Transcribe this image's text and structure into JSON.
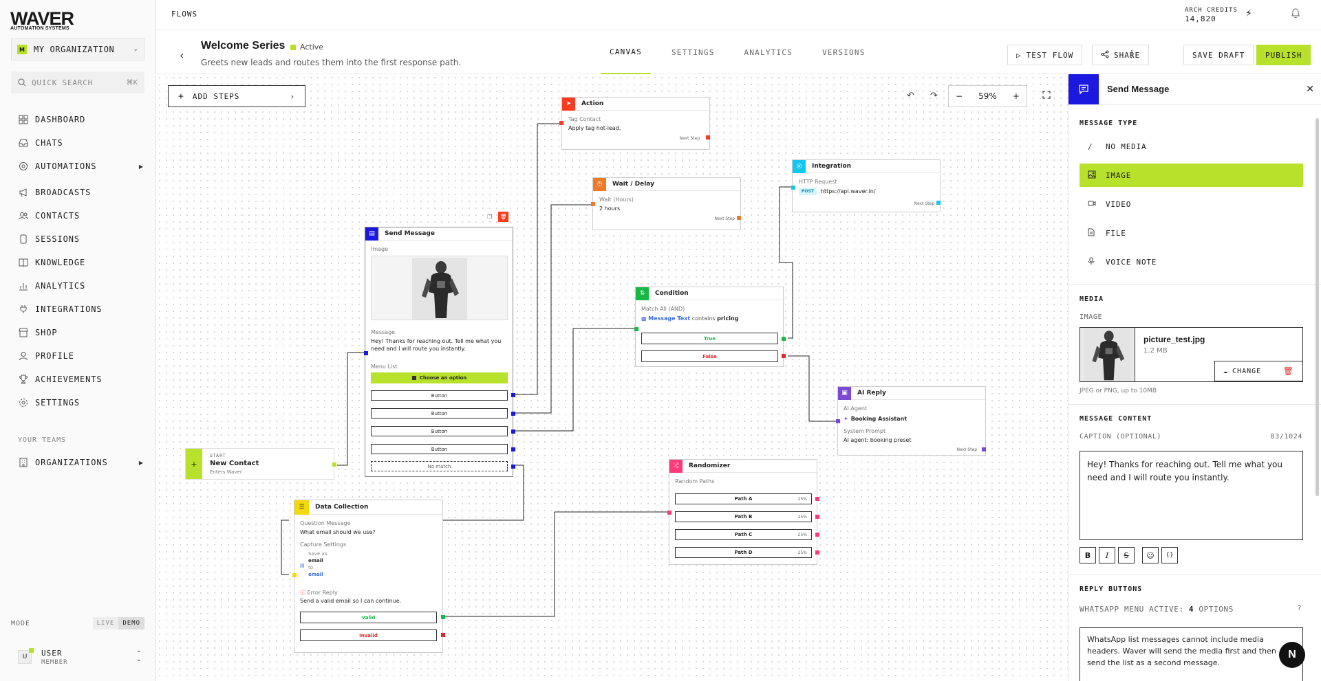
{
  "brand": {
    "name": "WAVER",
    "tagline": "AUTOMATION SYSTEMS"
  },
  "org": {
    "badge": "M",
    "name": "MY ORGANIZATION"
  },
  "search": {
    "placeholder": "QUICK SEARCH",
    "shortcut": "⌘K"
  },
  "nav": [
    {
      "label": "DASHBOARD",
      "icon": "dashboard-icon"
    },
    {
      "label": "CHATS",
      "icon": "inbox-icon"
    },
    {
      "label": "AUTOMATIONS",
      "icon": "automation-icon"
    },
    {
      "label": "BROADCASTS",
      "icon": "megaphone-icon"
    },
    {
      "label": "CONTACTS",
      "icon": "contacts-icon"
    },
    {
      "label": "SESSIONS",
      "icon": "phone-icon"
    },
    {
      "label": "KNOWLEDGE",
      "icon": "book-icon"
    },
    {
      "label": "ANALYTICS",
      "icon": "chart-icon"
    },
    {
      "label": "INTEGRATIONS",
      "icon": "plug-icon"
    },
    {
      "label": "SHOP",
      "icon": "shop-icon"
    },
    {
      "label": "PROFILE",
      "icon": "user-icon"
    },
    {
      "label": "ACHIEVEMENTS",
      "icon": "trophy-icon"
    },
    {
      "label": "SETTINGS",
      "icon": "gear-icon"
    }
  ],
  "teams": {
    "heading": "YOUR TEAMS",
    "item": "ORGANIZATIONS"
  },
  "mode": {
    "label": "MODE",
    "live": "LIVE",
    "demo": "DEMO"
  },
  "user": {
    "initial": "U",
    "name": "USER",
    "role": "MEMBER"
  },
  "topbar": {
    "breadcrumb": "FLOWS",
    "credits_label": "ARCH CREDITS",
    "credits_value": "14,820"
  },
  "flow": {
    "title": "Welcome Series",
    "status": "Active",
    "subtitle": "Greets new leads and routes them into the first response path."
  },
  "tabs": [
    "CANVAS",
    "SETTINGS",
    "ANALYTICS",
    "VERSIONS"
  ],
  "actions": {
    "test": "TEST FLOW",
    "share": "SHARE",
    "save": "SAVE DRAFT",
    "publish": "PUBLISH"
  },
  "canvas": {
    "add_steps": "ADD STEPS",
    "zoom": "59%"
  },
  "nodes": {
    "start": {
      "tag": "START",
      "title": "New Contact",
      "sub": "Enters Waver"
    },
    "action": {
      "title": "Action",
      "label": "Tag Contact",
      "text": "Apply tag hot-lead.",
      "next": "Next Step"
    },
    "wait": {
      "title": "Wait / Delay",
      "label": "Wait (Hours)",
      "text": "2 hours",
      "next": "Next Step"
    },
    "integration": {
      "title": "Integration",
      "label": "HTTP Request",
      "method": "POST",
      "url": "https://api.waver.in/",
      "next": "Next Step"
    },
    "send": {
      "title": "Send Message",
      "image_label": "Image",
      "msg_label": "Message",
      "msg": "Hey! Thanks for reaching out. Tell me what you need and I will route you instantly.",
      "menu_label": "Menu List",
      "choose": "Choose an option",
      "buttons": [
        "Button",
        "Button",
        "Button",
        "Button"
      ],
      "nomatch": "No match"
    },
    "condition": {
      "title": "Condition",
      "label": "Match All (AND)",
      "field": "Message Text",
      "op": "contains",
      "value": "pricing",
      "true": "True",
      "false": "False"
    },
    "aireply": {
      "title": "AI Reply",
      "label": "AI Agent",
      "agent": "Booking Assistant",
      "prompt_label": "System Prompt",
      "prompt": "AI agent: booking preset",
      "next": "Next Step"
    },
    "randomizer": {
      "title": "Randomizer",
      "label": "Random Paths",
      "paths": [
        {
          "name": "Path A",
          "pct": "25%"
        },
        {
          "name": "Path B",
          "pct": "25%"
        },
        {
          "name": "Path C",
          "pct": "25%"
        },
        {
          "name": "Path D",
          "pct": "25%"
        }
      ]
    },
    "datacol": {
      "title": "Data Collection",
      "q_label": "Question Message",
      "q": "What email should we use?",
      "cap_label": "Capture Settings",
      "save_as": "Save as",
      "field": "email",
      "to": "to",
      "target": "email",
      "err_label": "Error Reply",
      "err": "Send a valid email so I can continue.",
      "valid": "Valid",
      "invalid": "Invalid"
    }
  },
  "panel": {
    "title": "Send Message",
    "type_heading": "MESSAGE TYPE",
    "types": [
      {
        "label": "NO MEDIA",
        "icon": "slash-icon"
      },
      {
        "label": "IMAGE",
        "icon": "image-icon"
      },
      {
        "label": "VIDEO",
        "icon": "video-icon"
      },
      {
        "label": "FILE",
        "icon": "file-icon"
      },
      {
        "label": "VOICE NOTE",
        "icon": "mic-icon"
      }
    ],
    "media_heading": "MEDIA",
    "media_label": "IMAGE",
    "file_name": "picture_test.jpg",
    "file_size": "1.2 MB",
    "change": "CHANGE",
    "hint": "JPEG or PNG, up to 10MB",
    "content_heading": "MESSAGE CONTENT",
    "caption_label": "CAPTION (OPTIONAL)",
    "caption_count": "83/1024",
    "caption": "Hey! Thanks for reaching out. Tell me what you need and I will route you instantly.",
    "reply_heading": "REPLY BUTTONS",
    "menu_active": "WHATSAPP MENU ACTIVE:",
    "menu_count": "4",
    "menu_suffix": "OPTIONS",
    "help": "?",
    "info": "WhatsApp list messages cannot include media headers. Waver will send the media first and then send the list as a second message."
  },
  "assistant_badge": "N",
  "colors": {
    "accent": "#b8e12b",
    "send": "#1b18e0",
    "action": "#ff3b1f",
    "wait": "#ef7a28",
    "integration": "#14c6f0",
    "condition": "#18b847",
    "ai": "#7b49d6",
    "random": "#ff3a79",
    "data": "#f2d80c"
  }
}
